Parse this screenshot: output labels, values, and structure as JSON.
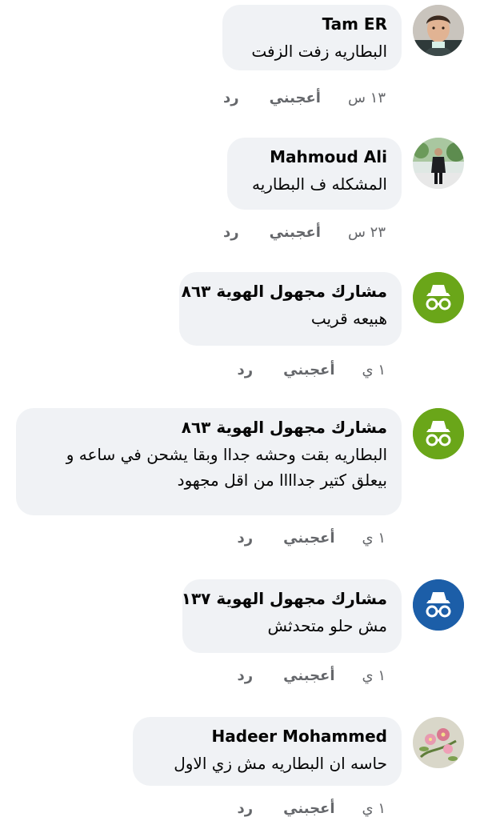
{
  "actions": {
    "like": "أعجبني",
    "reply": "رد"
  },
  "comments": [
    {
      "name": "Tam ER",
      "text": "البطاريه زفت الزفت",
      "time": "١٣ س",
      "avatar": "profile-photo-boy"
    },
    {
      "name": "Mahmoud Ali",
      "text": "المشكله ف البطاريه",
      "time": "٢٣ س",
      "avatar": "profile-photo-man"
    },
    {
      "name": "مشارك مجهول الهوية ٨٦٣",
      "text": "هبيعه قريب",
      "time": "١ ي",
      "avatar": "anonymous-icon"
    },
    {
      "name": "مشارك مجهول الهوية ٨٦٣",
      "text": "البطاريه بقت وحشه جداا وبقا يشحن في ساعه و بيعلق كتير جداااا من اقل مجهود",
      "time": "١ ي",
      "avatar": "anonymous-icon"
    },
    {
      "name": "مشارك مجهول الهوية ١٣٧",
      "text": "مش حلو متحدثش",
      "time": "١ ي",
      "avatar": "anonymous-icon"
    },
    {
      "name": "Hadeer Mohammed",
      "text": "حاسه ان البطاريه مش زي الاول",
      "time": "١ ي",
      "avatar": "profile-photo-flowers"
    }
  ],
  "colors": {
    "anon_green": "#6aa619",
    "anon_blue": "#1c5ea8",
    "bubble": "#f0f2f5",
    "meta": "#65676b"
  }
}
